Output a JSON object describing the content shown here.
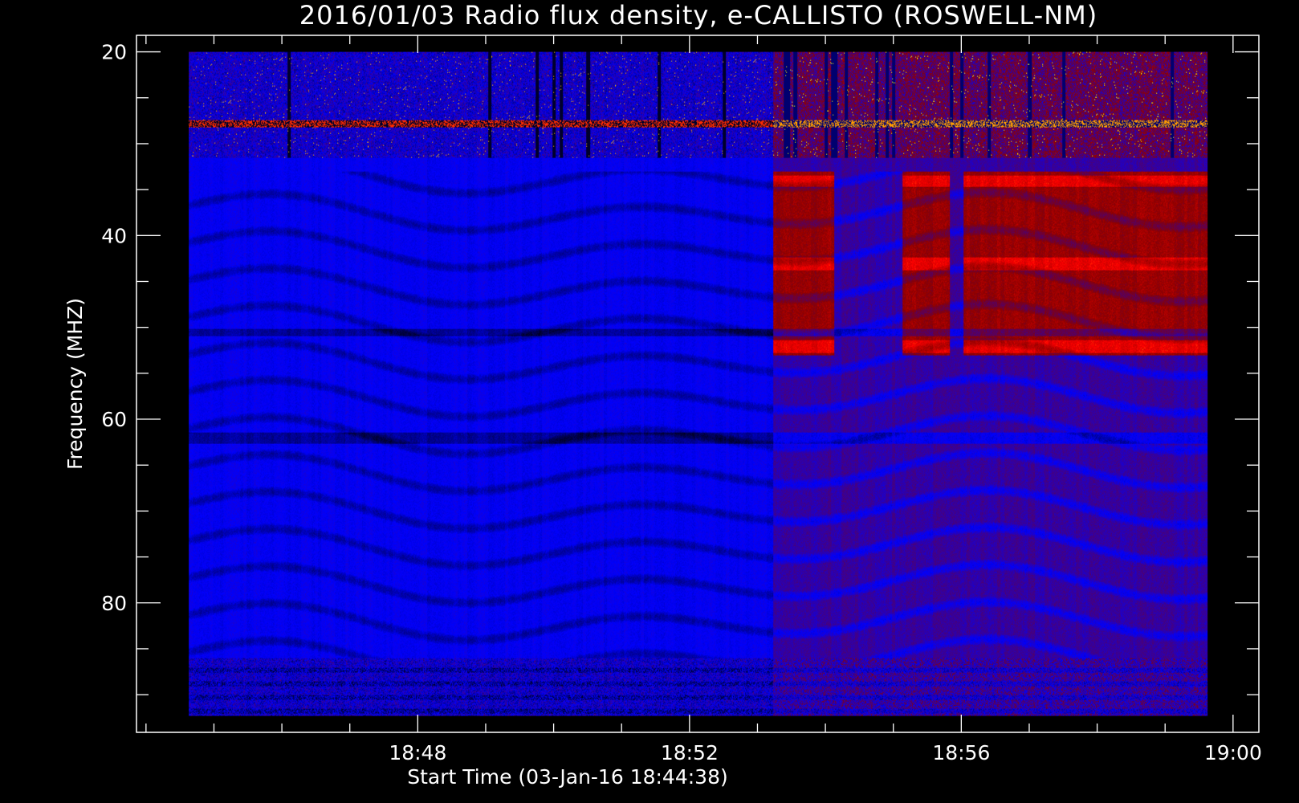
{
  "chart_data": {
    "type": "heatmap",
    "title": "2016/01/03  Radio flux density, e-CALLISTO (ROSWELL-NM)",
    "xlabel": "Start Time (03-Jan-16 18:44:38)",
    "ylabel": "Frequency (MHZ)",
    "x_ticks": [
      {
        "label": "18:48",
        "minutes": 3.37
      },
      {
        "label": "18:52",
        "minutes": 7.37
      },
      {
        "label": "18:56",
        "minutes": 11.37
      },
      {
        "label": "19:00",
        "minutes": 15.37
      }
    ],
    "x_minor_step_minutes": 1,
    "xlim_minutes": [
      -0.77,
      15.75
    ],
    "data_x_range_minutes": [
      0,
      15.0
    ],
    "y_ticks": [
      20,
      40,
      60,
      80
    ],
    "y_minor_step": 5,
    "ylim": [
      18.2,
      94.1
    ],
    "data_y_range": [
      20,
      92.3
    ],
    "y_inverted": true,
    "colormap": [
      "#000000",
      "#0000ff",
      "#8b0000",
      "#ff0000",
      "#ffff00"
    ],
    "background_color": "#000000",
    "burst_onset_minutes": 8.6,
    "burst_regions": [
      {
        "t_start": 8.6,
        "t_end": 9.5,
        "f_start": 33,
        "f_end": 53
      },
      {
        "t_start": 10.5,
        "t_end": 11.2,
        "f_start": 33,
        "f_end": 53
      },
      {
        "t_start": 11.4,
        "t_end": 15.0,
        "f_start": 33,
        "f_end": 53
      }
    ],
    "rfi_band_top_mhz": [
      20,
      31.5
    ],
    "rfi_band_bottom_mhz": [
      86,
      92.3
    ]
  }
}
